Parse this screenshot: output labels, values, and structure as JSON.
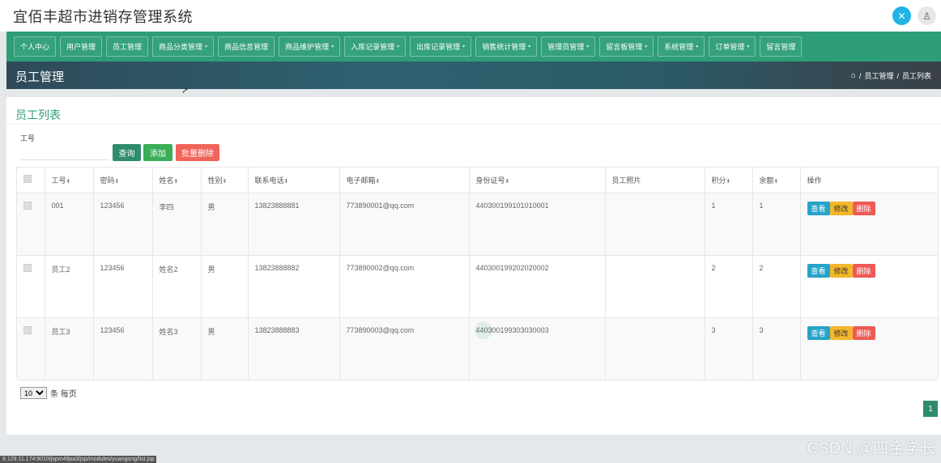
{
  "app": {
    "title": "宜佰丰超市进销存管理系统",
    "icons": {
      "fullscreen": "fullscreen-icon",
      "user": "user-icon"
    }
  },
  "nav": {
    "items": [
      {
        "label": "个人中心",
        "dropdown": false
      },
      {
        "label": "用户管理",
        "dropdown": false
      },
      {
        "label": "员工管理",
        "dropdown": false
      },
      {
        "label": "商品分类管理",
        "dropdown": true
      },
      {
        "label": "商品信息管理",
        "dropdown": false
      },
      {
        "label": "商品维护管理",
        "dropdown": true
      },
      {
        "label": "入库记录管理",
        "dropdown": true
      },
      {
        "label": "出库记录管理",
        "dropdown": true
      },
      {
        "label": "销售统计管理",
        "dropdown": true
      },
      {
        "label": "管理员管理",
        "dropdown": true
      },
      {
        "label": "留言板管理",
        "dropdown": true
      },
      {
        "label": "系统管理",
        "dropdown": true
      },
      {
        "label": "订单管理",
        "dropdown": true
      },
      {
        "label": "留言管理",
        "dropdown": false
      }
    ]
  },
  "page": {
    "title": "员工管理",
    "breadcrumb": [
      "员工管理",
      "员工列表"
    ],
    "breadcrumb_sep": "/"
  },
  "list": {
    "title": "员工列表",
    "search_label": "工号",
    "search_value": "",
    "buttons": {
      "query": "查询",
      "add": "添加",
      "batch_delete": "批量删除"
    },
    "columns": [
      "",
      "工号",
      "密码",
      "姓名",
      "性别",
      "联系电话",
      "电子邮箱",
      "身份证号",
      "员工照片",
      "积分",
      "余额",
      "操作"
    ],
    "sortable": [
      false,
      true,
      true,
      true,
      true,
      true,
      true,
      true,
      false,
      true,
      true,
      false
    ],
    "rows": [
      {
        "id": "001",
        "password": "123456",
        "name": "李四",
        "gender": "男",
        "phone": "13823888881",
        "email": "773890001@qq.com",
        "idcard": "440300199101010001",
        "photo": "",
        "points": "1",
        "balance": "1"
      },
      {
        "id": "员工2",
        "password": "123456",
        "name": "姓名2",
        "gender": "男",
        "phone": "13823888882",
        "email": "773890002@qq.com",
        "idcard": "440300199202020002",
        "photo": "",
        "points": "2",
        "balance": "2"
      },
      {
        "id": "员工3",
        "password": "123456",
        "name": "姓名3",
        "gender": "男",
        "phone": "13823888883",
        "email": "773890003@qq.com",
        "idcard": "440300199303030003",
        "photo": "",
        "points": "3",
        "balance": "3"
      }
    ],
    "ops": {
      "view": "查看",
      "edit": "修改",
      "delete": "删除"
    },
    "page_size": "10",
    "page_size_suffix": "条 每页",
    "current_page": "1"
  },
  "status_url": "8.129.11.174:9010/jspm49pa3/jsp/modules/yuangong/list.jsp",
  "watermark": "CSDN @四金学长",
  "colors": {
    "primary": "#2e9e78",
    "view": "#27a3c9",
    "edit": "#f3b72b",
    "delete": "#ef5a55"
  }
}
